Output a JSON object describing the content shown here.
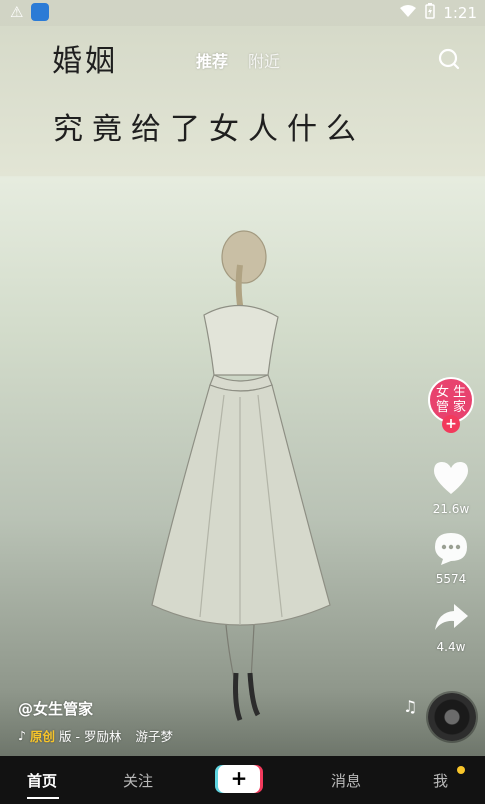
{
  "status_bar": {
    "time": "1:21"
  },
  "video": {
    "overlay_line1": "婚姻",
    "overlay_line2": "究竟给了女人什么"
  },
  "top_tabs": {
    "recommend": "推荐",
    "nearby": "附近"
  },
  "side": {
    "avatar_chars": [
      "女",
      "生",
      "管",
      "家"
    ],
    "likes": "21.6w",
    "comments": "5574",
    "shares": "4.4w"
  },
  "caption": {
    "author": "@女生管家",
    "music_original": "原创",
    "music_rest": "版 - 罗励林",
    "music_song": "游子梦"
  },
  "bottom_nav": {
    "home": "首页",
    "follow": "关注",
    "add": "+",
    "messages": "消息",
    "me": "我"
  },
  "colors": {
    "accent_pink": "#f23a5c",
    "accent_cyan": "#5fd4e0",
    "badge_yellow": "#f8c52a"
  }
}
